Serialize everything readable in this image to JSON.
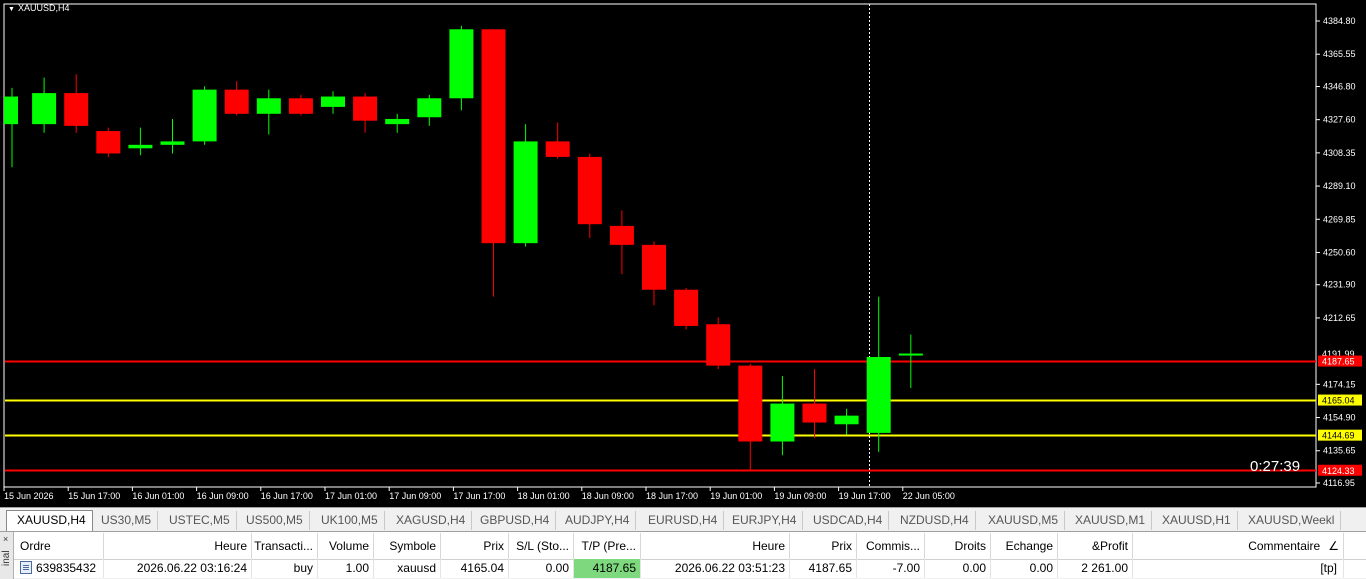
{
  "chart": {
    "title": "XAUUSD,H4",
    "countdown": "0:27:39",
    "price_scale": {
      "min": 4116.95,
      "max": 4384.8,
      "ticks": [
        "4384.80",
        "4365.55",
        "4346.80",
        "4327.60",
        "4308.35",
        "4289.10",
        "4269.85",
        "4250.60",
        "4231.90",
        "4212.65",
        "4174.15",
        "4154.90",
        "4135.65",
        "4116.95"
      ]
    },
    "price_labels": [
      {
        "text": "4191.99",
        "price": 4191.99,
        "bg": "#000000",
        "fg": "#ffffff",
        "line": false
      },
      {
        "text": "4187.65",
        "price": 4187.65,
        "bg": "#ff0000",
        "fg": "#ffffff",
        "line": true,
        "color": "#ff0000"
      },
      {
        "text": "4165.04",
        "price": 4165.04,
        "bg": "#ffff00",
        "fg": "#000000",
        "line": true,
        "color": "#ffff00"
      },
      {
        "text": "4144.69",
        "price": 4144.69,
        "bg": "#ffff00",
        "fg": "#000000",
        "line": true,
        "color": "#ffff00"
      },
      {
        "text": "4124.33",
        "price": 4124.33,
        "bg": "#ff0000",
        "fg": "#ffffff",
        "line": true,
        "color": "#ff0000"
      }
    ],
    "time_labels": [
      "15 Jun 2026",
      "15 Jun 17:00",
      "16 Jun 01:00",
      "16 Jun 09:00",
      "16 Jun 17:00",
      "17 Jun 01:00",
      "17 Jun 09:00",
      "17 Jun 17:00",
      "18 Jun 01:00",
      "18 Jun 09:00",
      "18 Jun 17:00",
      "19 Jun 01:00",
      "19 Jun 09:00",
      "19 Jun 17:00",
      "22 Jun 05:00"
    ],
    "colors": {
      "bull": "#00ff00",
      "bear": "#ff0000",
      "background": "#000000",
      "axis": "#ffffff",
      "crosshair": "#ffffff"
    }
  },
  "chart_data": {
    "type": "candlestick",
    "title": "XAUUSD,H4",
    "ylim": [
      4116.95,
      4384.8
    ],
    "candles": [
      {
        "o": 4325,
        "h": 4346,
        "l": 4300,
        "c": 4341
      },
      {
        "o": 4325,
        "h": 4352,
        "l": 4320,
        "c": 4343
      },
      {
        "o": 4343,
        "h": 4354,
        "l": 4320,
        "c": 4324
      },
      {
        "o": 4321,
        "h": 4323,
        "l": 4306,
        "c": 4308
      },
      {
        "o": 4311,
        "h": 4323,
        "l": 4307,
        "c": 4313
      },
      {
        "o": 4313,
        "h": 4328,
        "l": 4308,
        "c": 4315
      },
      {
        "o": 4315,
        "h": 4347,
        "l": 4313,
        "c": 4345
      },
      {
        "o": 4345,
        "h": 4350,
        "l": 4330,
        "c": 4331
      },
      {
        "o": 4331,
        "h": 4345,
        "l": 4319,
        "c": 4340
      },
      {
        "o": 4340,
        "h": 4342,
        "l": 4330,
        "c": 4331
      },
      {
        "o": 4335,
        "h": 4344,
        "l": 4331,
        "c": 4341
      },
      {
        "o": 4341,
        "h": 4343,
        "l": 4320,
        "c": 4327
      },
      {
        "o": 4325,
        "h": 4331,
        "l": 4320,
        "c": 4328
      },
      {
        "o": 4329,
        "h": 4342,
        "l": 4324,
        "c": 4340
      },
      {
        "o": 4340,
        "h": 4382,
        "l": 4333,
        "c": 4380
      },
      {
        "o": 4380,
        "h": 4380,
        "l": 4225,
        "c": 4256
      },
      {
        "o": 4256,
        "h": 4325,
        "l": 4254,
        "c": 4315
      },
      {
        "o": 4315,
        "h": 4326,
        "l": 4305,
        "c": 4306
      },
      {
        "o": 4306,
        "h": 4308,
        "l": 4259,
        "c": 4267
      },
      {
        "o": 4266,
        "h": 4275,
        "l": 4238,
        "c": 4255
      },
      {
        "o": 4255,
        "h": 4257,
        "l": 4220,
        "c": 4229
      },
      {
        "o": 4229,
        "h": 4230,
        "l": 4206,
        "c": 4208
      },
      {
        "o": 4209,
        "h": 4213,
        "l": 4183,
        "c": 4185
      },
      {
        "o": 4185,
        "h": 4186,
        "l": 4124,
        "c": 4141
      },
      {
        "o": 4141,
        "h": 4179,
        "l": 4133,
        "c": 4163
      },
      {
        "o": 4163,
        "h": 4183,
        "l": 4143,
        "c": 4152
      },
      {
        "o": 4151,
        "h": 4160,
        "l": 4145,
        "c": 4156
      },
      {
        "o": 4146,
        "h": 4225,
        "l": 4135,
        "c": 4190
      },
      {
        "o": 4191,
        "h": 4203,
        "l": 4172,
        "c": 4192
      }
    ]
  },
  "tabs": [
    {
      "label": "XAUUSD,H4",
      "active": true
    },
    {
      "label": "US30,M5"
    },
    {
      "label": "USTEC,M5"
    },
    {
      "label": "US500,M5"
    },
    {
      "label": "UK100,M5"
    },
    {
      "label": "XAGUSD,H4"
    },
    {
      "label": "GBPUSD,H4"
    },
    {
      "label": "AUDJPY,H4"
    },
    {
      "label": "EURUSD,H4"
    },
    {
      "label": "EURJPY,H4"
    },
    {
      "label": "USDCAD,H4"
    },
    {
      "label": "NZDUSD,H4"
    },
    {
      "label": "XAUUSD,M5"
    },
    {
      "label": "XAUUSD,M1"
    },
    {
      "label": "XAUUSD,H1"
    },
    {
      "label": "XAUUSD,Weekl"
    }
  ],
  "terminal": {
    "side_label": "inal",
    "close_glyph": "×",
    "headers": [
      "Ordre",
      "Heure",
      "Transacti...",
      "Volume",
      "Symbole",
      "Prix",
      "S/L (Sto...",
      "T/P (Pre...",
      "Heure",
      "Prix",
      "Commis...",
      "Droits",
      "Echange",
      "&Profit",
      "Commentaire"
    ],
    "sort_arrow": "∠",
    "row": [
      "639835432",
      "2026.06.22 03:16:24",
      "buy",
      "1.00",
      "xauusd",
      "4165.04",
      "0.00",
      "4187.65",
      "2026.06.22 03:51:23",
      "4187.65",
      "-7.00",
      "0.00",
      "0.00",
      "2 261.00",
      "[tp]"
    ]
  }
}
